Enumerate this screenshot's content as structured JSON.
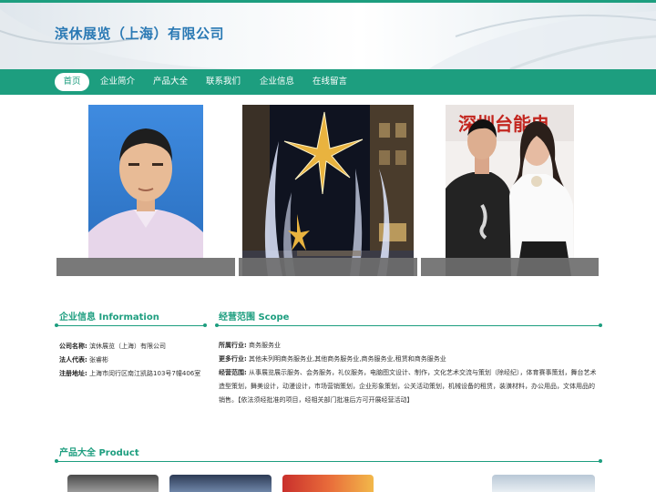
{
  "header": {
    "company_name": "滨休展览（上海）有限公司"
  },
  "nav": {
    "items": [
      {
        "label": "首页",
        "active": true
      },
      {
        "label": "企业简介"
      },
      {
        "label": "产品大全"
      },
      {
        "label": "联系我们"
      },
      {
        "label": "企业信息"
      },
      {
        "label": "在线留言"
      }
    ]
  },
  "gallery": {
    "photos": [
      {
        "name": "portrait-photo"
      },
      {
        "name": "street-lights-photo"
      },
      {
        "name": "event-photo",
        "sign_text": "深圳台能电"
      }
    ]
  },
  "company_info": {
    "title": "企业信息 Information",
    "rows": [
      {
        "label": "公司名称:",
        "value": "滨休展览（上海）有限公司"
      },
      {
        "label": "法人代表:",
        "value": "张睿彬"
      },
      {
        "label": "注册地址:",
        "value": "上海市闵行区南江凯路103号7幢406室"
      }
    ]
  },
  "scope": {
    "title": "经营范围 Scope",
    "industry_label": "所属行业:",
    "industry_value": "商务服务业",
    "more_label": "更多行业:",
    "more_value": "其他未列明商务服务业,其他商务服务业,商务服务业,租赁和商务服务业",
    "business_label": "经营范围:",
    "business_value": "从事展览展示服务、会务服务，礼仪服务，电脑图文设计、制作，文化艺术交流与策划（除经纪），体育赛事策划，舞台艺术造型策划，舞美设计，动漫设计，市场营销策划，企业形象策划，公关活动策划，机械设备的租赁，装潢材料，办公用品，文体用品的销售。【依法须经批准的项目，经相关部门批准后方可开展经营活动】"
  },
  "products": {
    "title": "产品大全 Product"
  }
}
